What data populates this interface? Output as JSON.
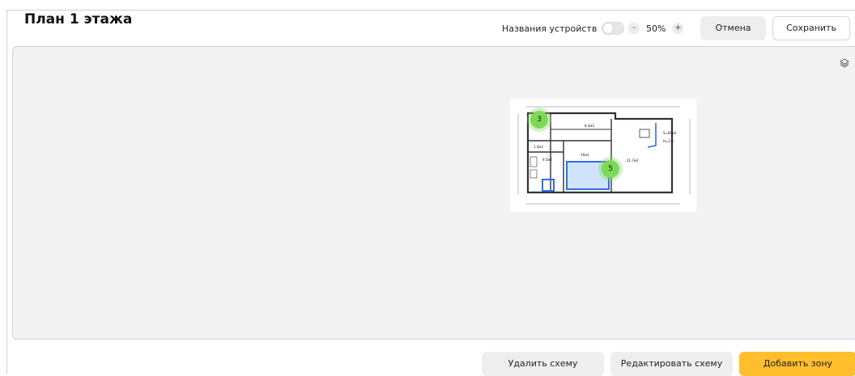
{
  "header": {
    "title": "План 1 этажа"
  },
  "toolbar": {
    "device_names_label": "Названия устройств",
    "device_names_on": false,
    "zoom_minus": "-",
    "zoom_value": "50%",
    "zoom_plus": "+",
    "cancel_label": "Отмена",
    "save_label": "Сохранить"
  },
  "canvas": {
    "layers_icon": "layers-icon",
    "plan": {
      "rooms": [
        {
          "label": "8.3м2"
        },
        {
          "label": "1.4м2"
        },
        {
          "label": "16м2"
        },
        {
          "label": "9.5м2"
        },
        {
          "label": "21.7м2"
        },
        {
          "label": "S=60м2"
        },
        {
          "label": "H=2.6"
        }
      ],
      "markers": [
        {
          "label": "3"
        },
        {
          "label": "5"
        }
      ],
      "marker_color": "#7ed957",
      "highlight_color": "#2f6fe0"
    }
  },
  "footer": {
    "delete_label": "Удалить схему",
    "edit_label": "Редактировать схему",
    "add_zone_label": "Добавить зону",
    "accent_color": "#ffbe2e"
  }
}
